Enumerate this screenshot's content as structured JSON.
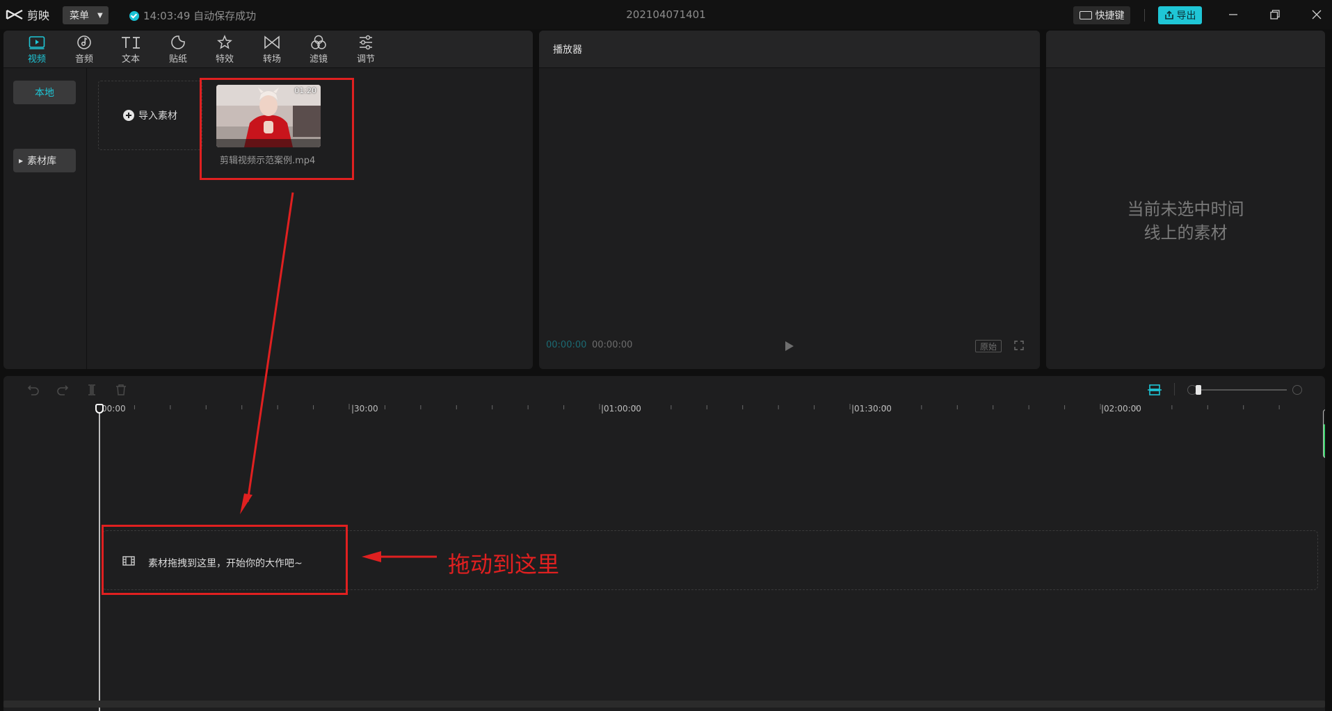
{
  "app": {
    "name": "剪映",
    "menu_label": "菜单",
    "autosave": "14:03:49 自动保存成功",
    "project_title": "202104071401",
    "shortcut_label": "快捷键",
    "export_label": "导出"
  },
  "tools": [
    {
      "label": "视频",
      "icon": "video-icon"
    },
    {
      "label": "音频",
      "icon": "audio-icon"
    },
    {
      "label": "文本",
      "icon": "text-icon"
    },
    {
      "label": "贴纸",
      "icon": "sticker-icon"
    },
    {
      "label": "特效",
      "icon": "effects-icon"
    },
    {
      "label": "转场",
      "icon": "transition-icon"
    },
    {
      "label": "滤镜",
      "icon": "filter-icon"
    },
    {
      "label": "调节",
      "icon": "adjust-icon"
    }
  ],
  "sidebar": {
    "local": "本地",
    "library": "素材库"
  },
  "media": {
    "import_label": "导入素材",
    "clip": {
      "duration": "01:20",
      "filename": "剪辑视频示范案例.mp4"
    }
  },
  "player": {
    "title": "播放器",
    "current_time": "00:00:00",
    "total_time": "00:00:00",
    "ratio_label": "原始"
  },
  "properties": {
    "empty_line1": "当前未选中时间",
    "empty_line2": "线上的素材"
  },
  "timeline": {
    "ruler_labels": [
      "00:00",
      "|30:00",
      "|01:00:00",
      "|01:30:00",
      "|02:00:00"
    ],
    "drop_hint": "素材拖拽到这里，开始你的大作吧~"
  },
  "annotation": {
    "text": "拖动到这里",
    "color": "#e02020"
  },
  "colors": {
    "accent": "#1fc6d6",
    "panel": "#1e1e1f",
    "background": "#0f0f0f"
  }
}
